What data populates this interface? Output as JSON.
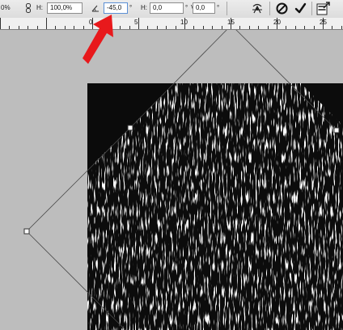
{
  "options_bar": {
    "width_value_partial": "0%",
    "height_label": "H:",
    "height_value": "100,0%",
    "angle_value": "-45,0",
    "degree_symbol": "°",
    "h_skew_label": "H:",
    "h_skew_value": "0,0",
    "v_skew_label": "V:",
    "v_skew_value": "0,0",
    "degree_symbol_2": "°",
    "degree_symbol_3": "°"
  },
  "ruler": {
    "labels": [
      "0",
      "5",
      "10",
      "15",
      "20",
      "25"
    ]
  },
  "icons": {
    "link": "link-icon",
    "angle": "angle-icon",
    "warp": "warp-icon",
    "cancel": "cancel-icon",
    "commit": "commit-checkmark-icon",
    "panel": "panel-icon"
  },
  "colors": {
    "annotation_arrow": "#e8191c",
    "canvas_bg": "#bdbdbd",
    "image_fill": "#0c0c0c"
  }
}
